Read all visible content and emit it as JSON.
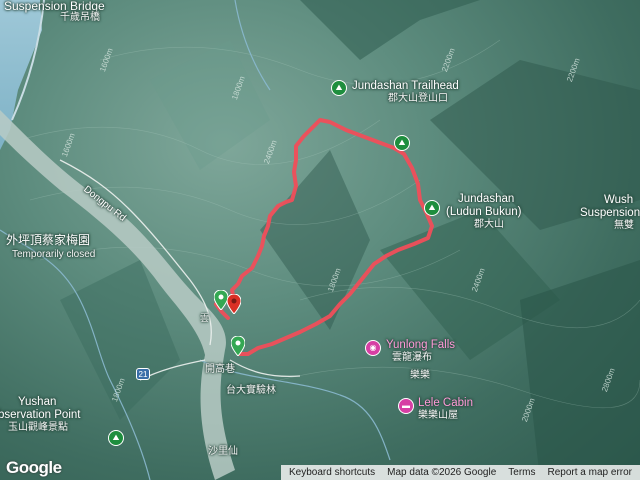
{
  "labels": {
    "suspension_bridge": "Suspension Bridge",
    "qianzui_bridge": "千歲吊橋",
    "trailhead_en": "Jundashan Trailhead",
    "trailhead_zh": "郡大山登山口",
    "peak_en_1": "Jundashan",
    "peak_en_2": "(Ludun Bukun)",
    "peak_zh": "郡大山",
    "wush_1": "Wush",
    "wush_2": "Suspension",
    "wush_zh": "無雙",
    "dongpu_rd": "Dongpu Rd",
    "farm_zh": "外坪頂蔡家梅園",
    "temp_closed": "Temporarily closed",
    "falls_en": "Yunlong Falls",
    "falls_zh": "雲龍瀑布",
    "lele_area": "樂樂",
    "cabin_en": "Lele Cabin",
    "cabin_zh": "樂樂山屋",
    "kaigao": "開高巷",
    "ntu_farm": "台大實驗林",
    "yushan_1": "Yushan",
    "yushan_2": "bservation Point",
    "yushan_zh": "玉山觀峰景點",
    "shalixian": "沙里仙",
    "road_21": "21",
    "side_zh": "",
    "small_label": "雲"
  },
  "elevations": [
    "2200m",
    "2200m",
    "1600m",
    "1600m",
    "2400m",
    "1800m",
    "1800m",
    "2400m",
    "2000m",
    "1800m",
    "2800m"
  ],
  "route_color": "#f04e5a",
  "google_logo": "Google",
  "attribution": {
    "shortcuts": "Keyboard shortcuts",
    "data": "Map data ©2026 Google",
    "terms": "Terms",
    "report": "Report a map error"
  }
}
